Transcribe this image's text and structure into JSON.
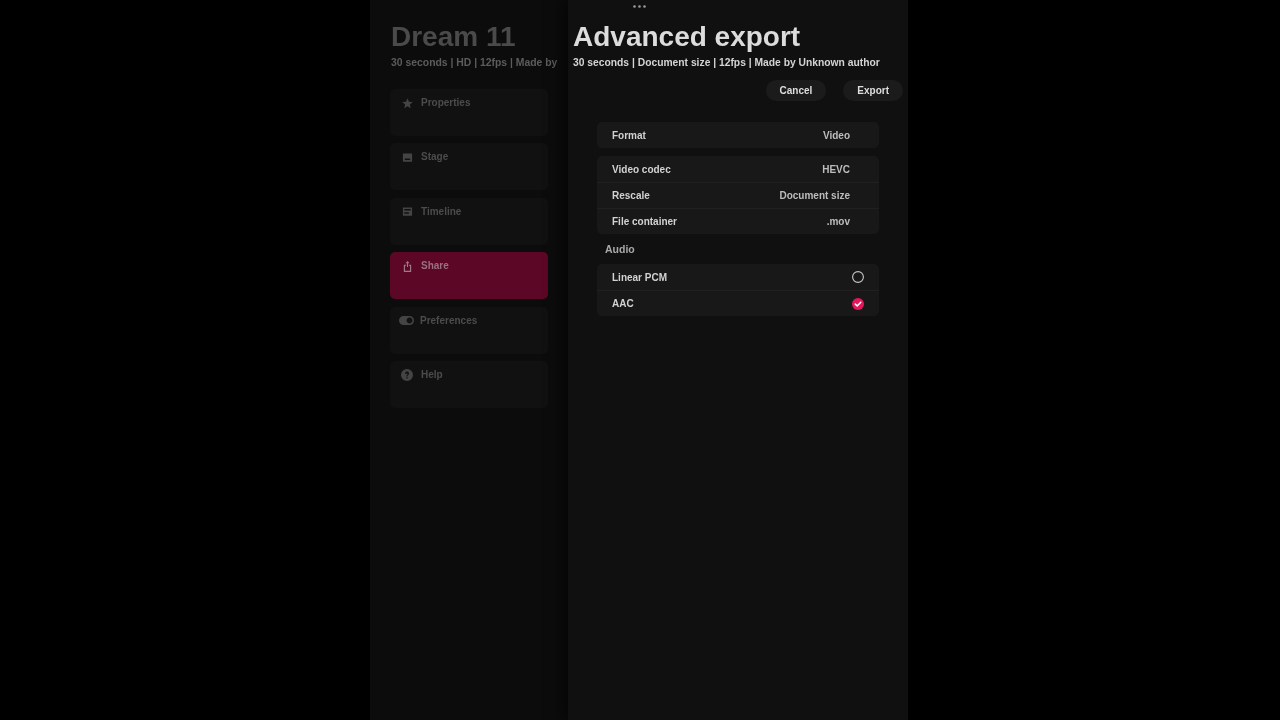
{
  "background_app": {
    "title": "Dream 11",
    "meta": "30 seconds | HD | 12fps | Made by",
    "sidebar": {
      "items": [
        {
          "label": "Properties",
          "selected": false
        },
        {
          "label": "Stage",
          "selected": false
        },
        {
          "label": "Timeline",
          "selected": false
        },
        {
          "label": "Share",
          "selected": true
        },
        {
          "label": "Preferences",
          "selected": false
        },
        {
          "label": "Help",
          "selected": false
        }
      ]
    }
  },
  "sheet": {
    "title": "Advanced export",
    "meta": "30 seconds | Document size | 12fps | Made by Unknown author",
    "buttons": [
      "Cancel",
      "Export"
    ],
    "groups": [
      {
        "rows": [
          {
            "kind": "value",
            "label": "Format",
            "value": "Video"
          }
        ]
      },
      {
        "rows": [
          {
            "kind": "value",
            "label": "Video codec",
            "value": "HEVC"
          },
          {
            "kind": "value",
            "label": "Rescale",
            "value": "Document size"
          },
          {
            "kind": "value",
            "label": "File container",
            "value": ".mov"
          }
        ]
      },
      {
        "header": "Audio",
        "rows": [
          {
            "kind": "radio",
            "label": "Linear PCM",
            "selected": false
          },
          {
            "kind": "radio",
            "label": "AAC",
            "selected": true
          }
        ]
      }
    ]
  }
}
